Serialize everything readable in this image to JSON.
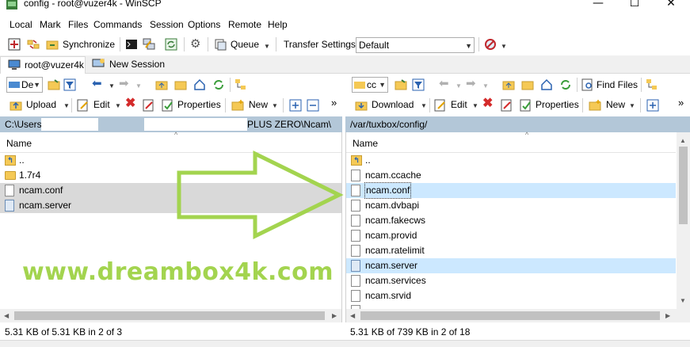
{
  "window": {
    "title": "config - root@vuzer4k - WinSCP",
    "minimize": "—",
    "maximize": "☐",
    "close": "✕"
  },
  "menu": {
    "items": [
      "Local",
      "Mark",
      "Files",
      "Commands",
      "Session",
      "Options",
      "Remote",
      "Help"
    ]
  },
  "toolbar": {
    "synchronize": "Synchronize",
    "queue": "Queue",
    "transfer_settings": "Transfer Settings",
    "transfer_default": "Default"
  },
  "tabs": {
    "session": "root@vuzer4k",
    "new_session": "New Session"
  },
  "local": {
    "drive": "De",
    "upload": "Upload",
    "edit": "Edit",
    "properties": "Properties",
    "new": "New",
    "path_start": "C:\\Users",
    "path_end": "PLUS ZERO\\Ncam\\",
    "column_name": "Name",
    "files": [
      {
        "name": "..",
        "type": "up"
      },
      {
        "name": "1.7r4",
        "type": "folder"
      },
      {
        "name": "ncam.conf",
        "type": "file"
      },
      {
        "name": "ncam.server",
        "type": "server"
      }
    ],
    "status": "5.31 KB of 5.31 KB in 2 of 3"
  },
  "remote": {
    "drive": "cc",
    "find_files": "Find Files",
    "download": "Download",
    "edit": "Edit",
    "properties": "Properties",
    "new": "New",
    "path": "/var/tuxbox/config/",
    "column_name": "Name",
    "files": [
      {
        "name": "..",
        "type": "up"
      },
      {
        "name": "ncam.ccache",
        "type": "file"
      },
      {
        "name": "ncam.conf",
        "type": "file"
      },
      {
        "name": "ncam.dvbapi",
        "type": "file"
      },
      {
        "name": "ncam.fakecws",
        "type": "file"
      },
      {
        "name": "ncam.provid",
        "type": "file"
      },
      {
        "name": "ncam.ratelimit",
        "type": "file"
      },
      {
        "name": "ncam.server",
        "type": "server"
      },
      {
        "name": "ncam.services",
        "type": "file"
      },
      {
        "name": "ncam.srvid",
        "type": "file"
      }
    ],
    "status": "5.31 KB of 739 KB in 2 of 18"
  },
  "watermark": "www.dreambox4k.com",
  "colors": {
    "path_bar": "#b3c7d8",
    "selection_gray": "#d9d9d9",
    "selection_blue": "#cce8ff",
    "watermark_green": "#a3d44f"
  }
}
